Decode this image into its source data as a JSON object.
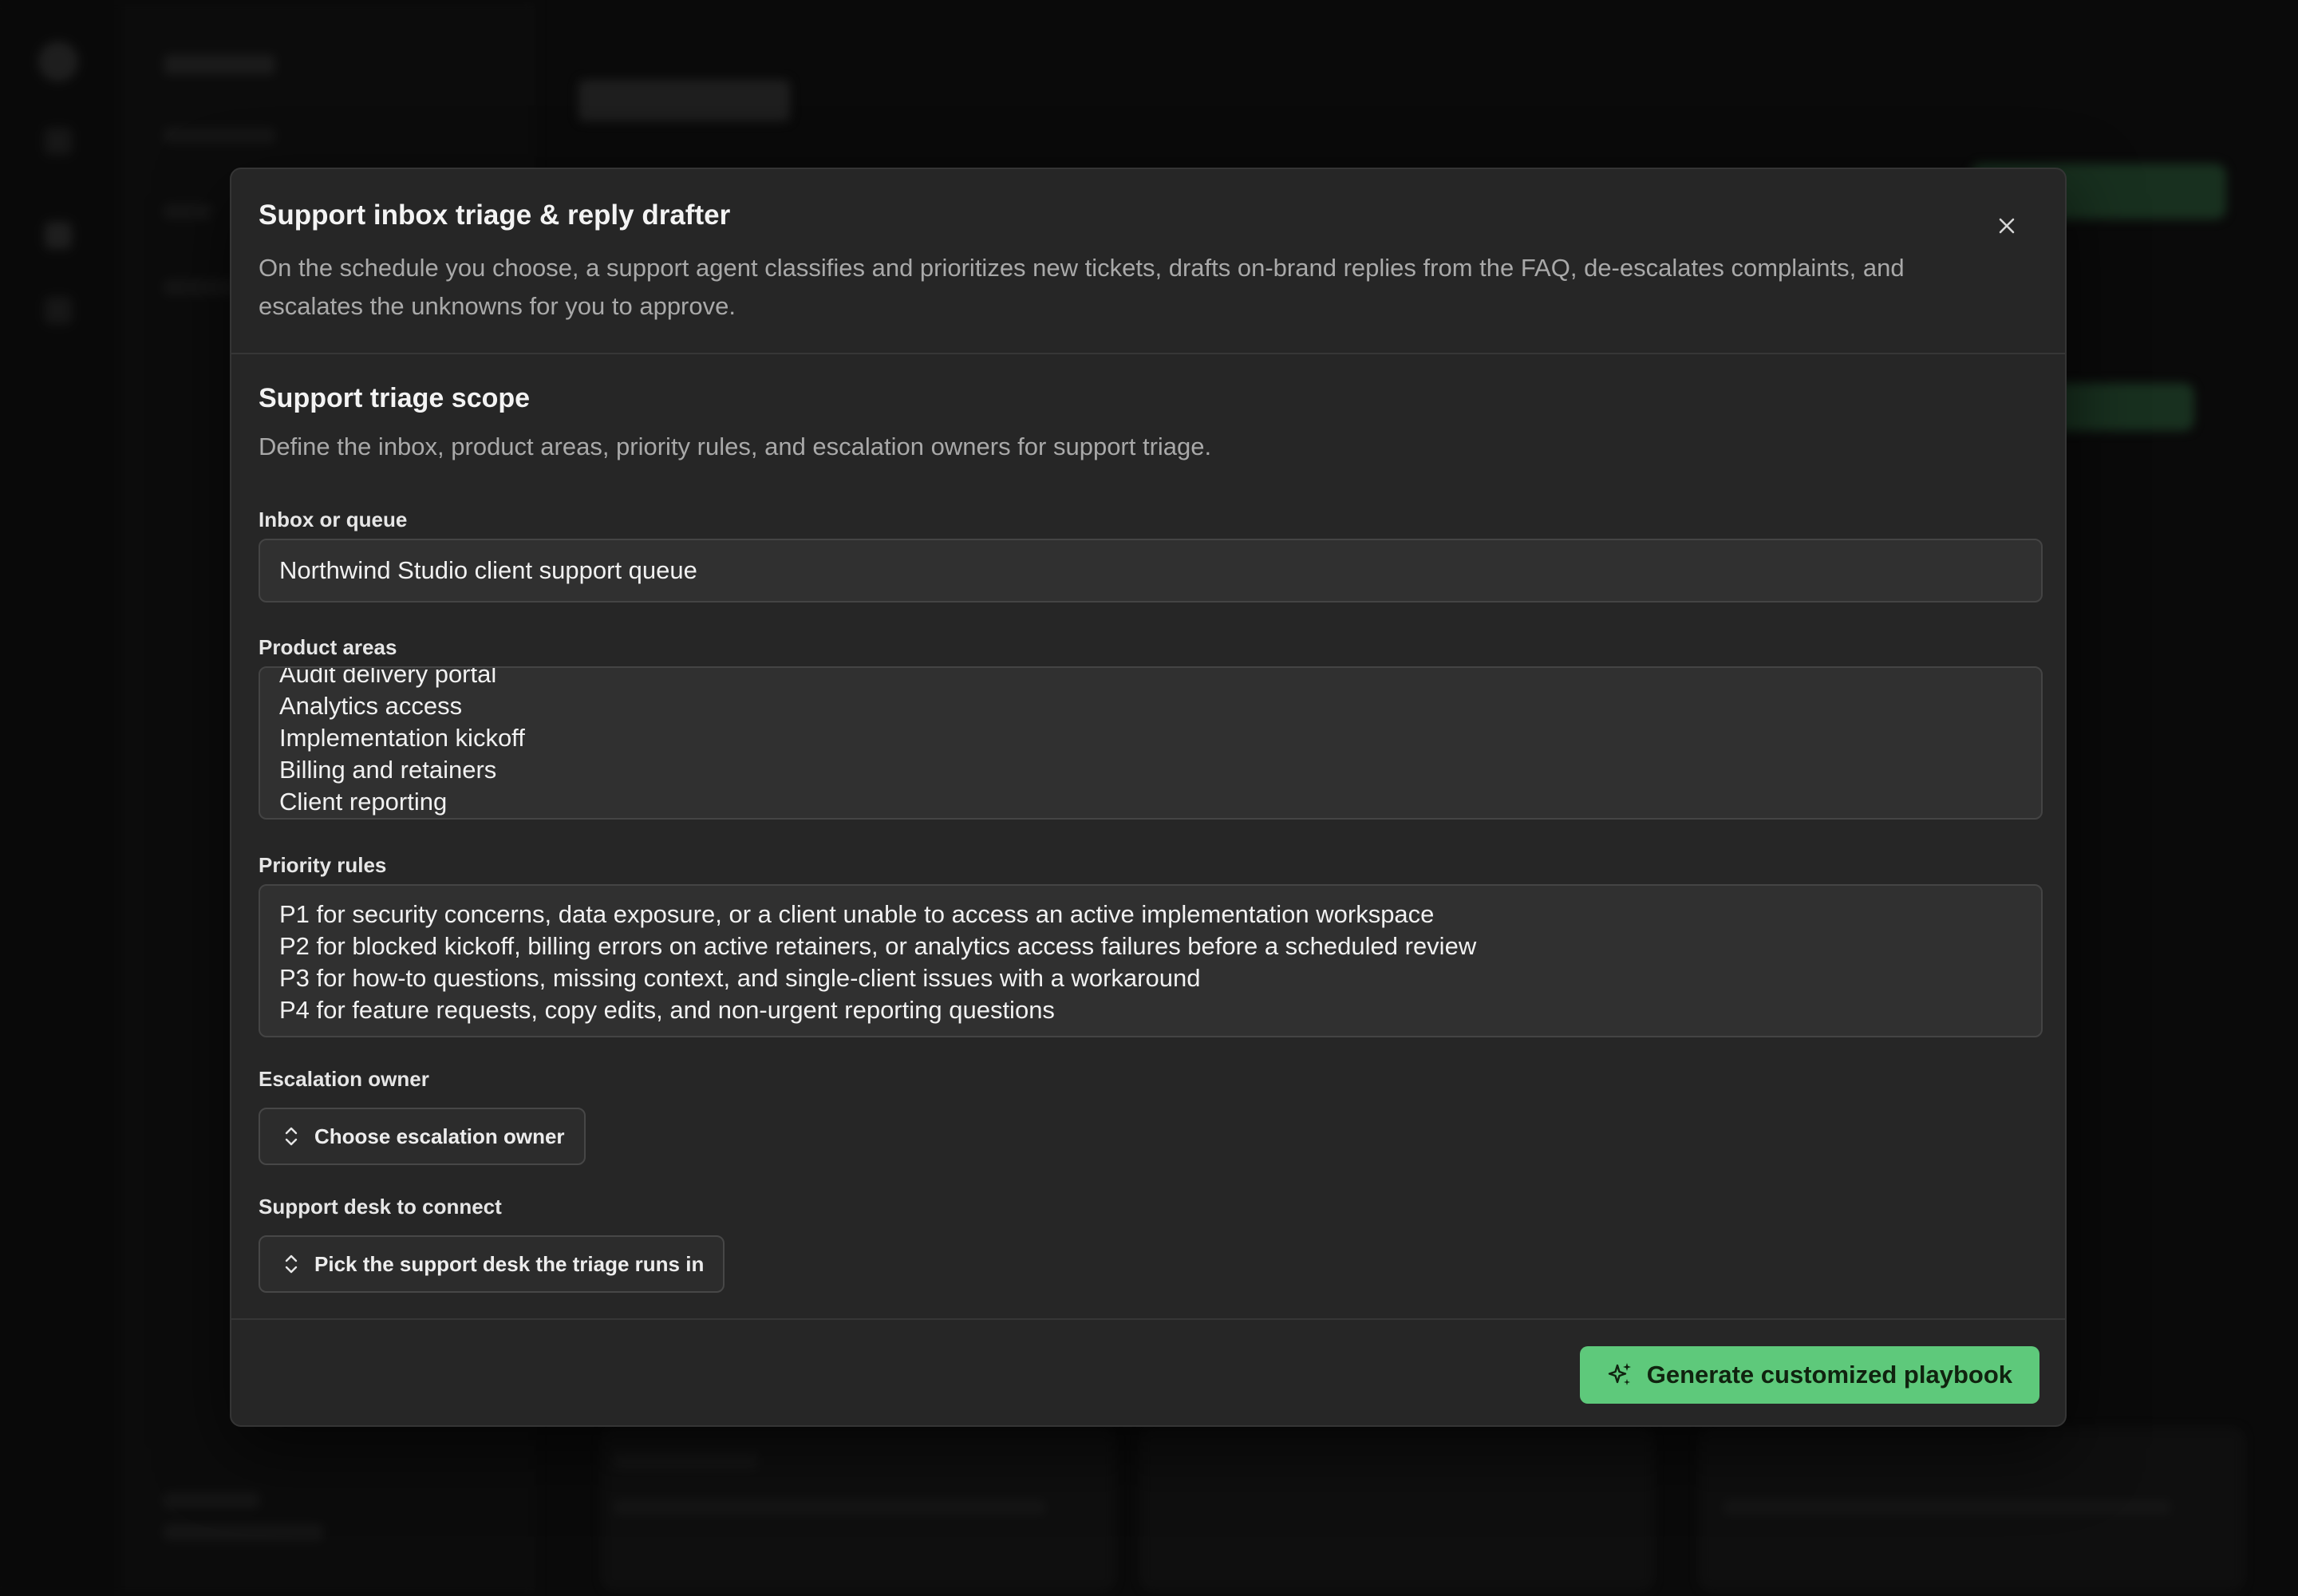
{
  "modal": {
    "title": "Support inbox triage & reply drafter",
    "description": "On the schedule you choose, a support agent classifies and prioritizes new tickets, drafts on-brand replies from the FAQ, de-escalates complaints, and escalates the unknowns for you to approve.",
    "close_icon": "close-icon"
  },
  "section": {
    "title": "Support triage scope",
    "description": "Define the inbox, product areas, priority rules, and escalation owners for support triage."
  },
  "fields": {
    "inbox": {
      "label": "Inbox or queue",
      "value": "Northwind Studio client support queue"
    },
    "product_areas": {
      "label": "Product areas",
      "lines": [
        "Audit delivery portal",
        "Analytics access",
        "Implementation kickoff",
        "Billing and retainers",
        "Client reporting"
      ]
    },
    "priority_rules": {
      "label": "Priority rules",
      "lines": [
        "P1 for security concerns, data exposure, or a client unable to access an active implementation workspace",
        "P2 for blocked kickoff, billing errors on active retainers, or analytics access failures before a scheduled review",
        "P3 for how-to questions, missing context, and single-client issues with a workaround",
        "P4 for feature requests, copy edits, and non-urgent reporting questions"
      ]
    },
    "escalation_owner": {
      "label": "Escalation owner",
      "button_label": "Choose escalation owner",
      "icon": "chevron-up-down-icon"
    },
    "support_desk": {
      "label": "Support desk to connect",
      "button_label": "Pick the support desk the triage runs in",
      "icon": "chevron-up-down-icon"
    }
  },
  "footer": {
    "generate_label": "Generate customized playbook",
    "generate_icon": "sparkles-icon"
  },
  "colors": {
    "accent": "#5ec97b",
    "modal_bg": "#262626",
    "field_bg": "#303030"
  }
}
